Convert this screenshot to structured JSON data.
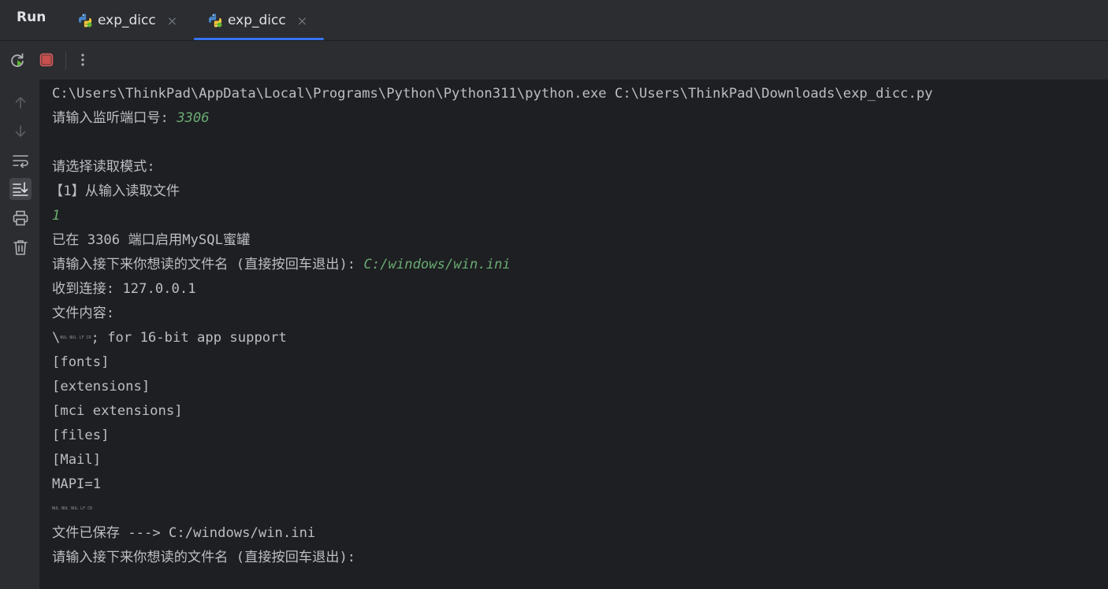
{
  "tabs": {
    "run_title": "Run",
    "items": [
      {
        "label": "exp_dicc"
      },
      {
        "label": "exp_dicc"
      }
    ],
    "close_glyph": "×",
    "active_color": "#3574f0"
  },
  "toolbar": {
    "rerun_icon": "rerun-icon",
    "stop_icon": "stop-icon",
    "more_icon": "more-vertical-icon"
  },
  "gutter": {
    "icons": [
      "scroll-up-icon",
      "scroll-down-icon",
      "soft-wrap-icon",
      "scroll-to-end-icon",
      "print-icon",
      "trash-icon"
    ]
  },
  "console": {
    "cmd": "C:\\Users\\ThinkPad\\AppData\\Local\\Programs\\Python\\Python311\\python.exe C:\\Users\\ThinkPad\\Downloads\\exp_dicc.py",
    "port_prompt": "请输入监听端口号: ",
    "port_value": "3306",
    "mode_prompt": "请选择读取模式:",
    "mode_option": "【1】从输入读取文件",
    "mode_value": "1",
    "started": "已在 3306 端口启用MySQL蜜罐",
    "file_prompt": "请输入接下来你想读的文件名 (直接按回车退出): ",
    "file_value": "C:/windows/win.ini",
    "received": "收到连接: 127.0.0.1",
    "content_label": "文件内容:",
    "content_prefix": "\\",
    "content_ctrl": "NUL NUL LF CR",
    "content_rest": "; for 16-bit app support",
    "fonts": "[fonts]",
    "extensions": "[extensions]",
    "mci_extensions": "[mci extensions]",
    "files": "[files]",
    "mail": "[Mail]",
    "mapi": "MAPI=1",
    "ctrl_line": "NUL NUL NUL LF CR",
    "saved": "文件已保存 ---> C:/windows/win.ini",
    "file_prompt2": "请输入接下来你想读的文件名 (直接按回车退出):",
    "input_color": "#6aab73"
  }
}
